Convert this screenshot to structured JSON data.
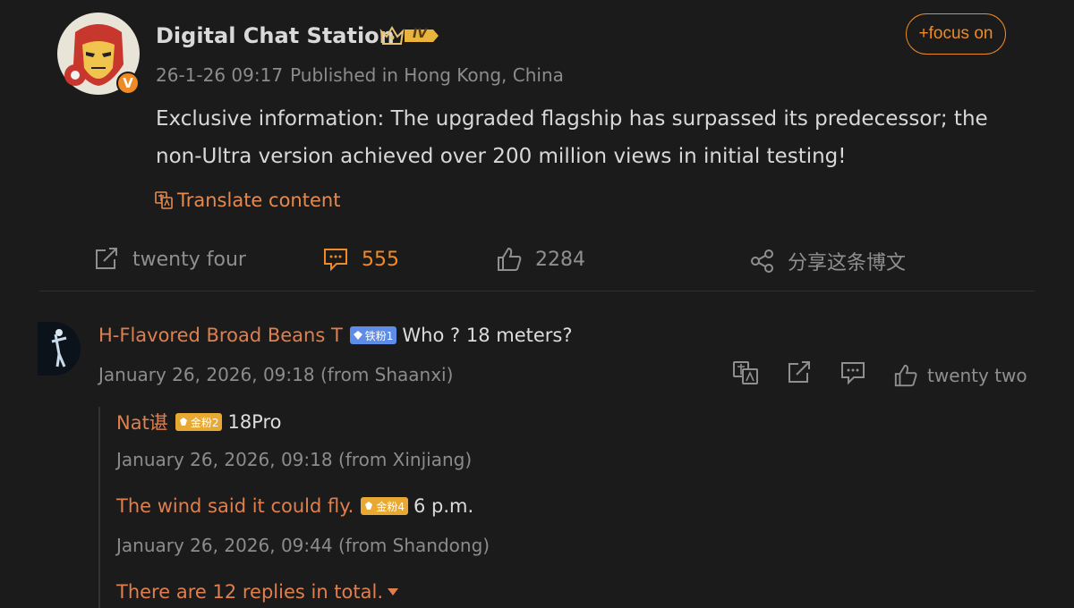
{
  "post": {
    "author": "Digital Chat Station",
    "level_badge": "IV",
    "verified_mark": "V",
    "date": "26-1-26 09:17",
    "location": "Published in Hong Kong, China",
    "follow_label": "+focus on",
    "text": "Exclusive information: The upgraded flagship has surpassed its predecessor; the non-Ultra version achieved over 200 million views in initial testing!",
    "translate_label": "Translate content",
    "actions": {
      "forward": "twenty four",
      "comments": "555",
      "likes": "2284",
      "share": "分享这条博文"
    }
  },
  "comment": {
    "author": "H-Flavored Broad Beans T",
    "badge": "铁粉1",
    "text": "Who ? 18 meters?",
    "time": "January 26, 2026, 09:18 (from Shaanxi)",
    "likes": "twenty two"
  },
  "replies": [
    {
      "author": "Nat谌",
      "badge": "金粉2",
      "text": "18Pro",
      "time": "January 26, 2026, 09:18 (from Xinjiang)"
    },
    {
      "author": "The wind said it could fly.",
      "badge": "金粉4",
      "text": "6 p.m.",
      "time": "January 26, 2026, 09:44 (from Shandong)"
    }
  ],
  "more_replies": "There are 12 replies in total.",
  "colors": {
    "background": "#1b1b1b",
    "accent": "#f08a24",
    "link": "#e07f4e",
    "muted": "#8c8c8c"
  },
  "icons": [
    "ironman-avatar",
    "crown-icon",
    "translate-icon",
    "forward-icon",
    "comment-icon",
    "like-icon",
    "share-icon",
    "caret-down-icon"
  ]
}
